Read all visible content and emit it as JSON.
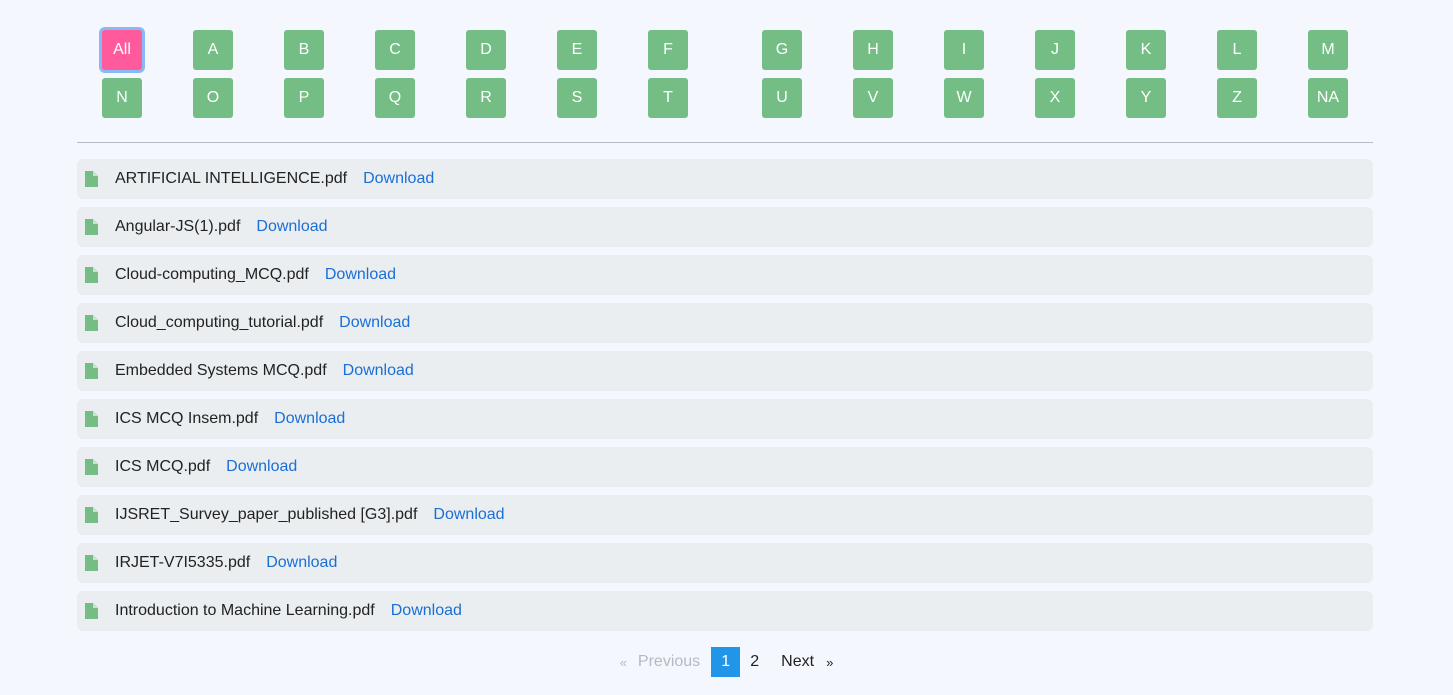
{
  "alphabet_filter": {
    "row1": [
      "All",
      "A",
      "B",
      "C",
      "D",
      "E",
      "F",
      "G",
      "H",
      "I",
      "J",
      "K",
      "L",
      "M"
    ],
    "row2": [
      "N",
      "O",
      "P",
      "Q",
      "R",
      "S",
      "T",
      "U",
      "V",
      "W",
      "X",
      "Y",
      "Z",
      "NA"
    ],
    "active": "All"
  },
  "files": [
    {
      "name": "ARTIFICIAL INTELLIGENCE.pdf",
      "link": "Download"
    },
    {
      "name": "Angular-JS(1).pdf",
      "link": "Download"
    },
    {
      "name": "Cloud-computing_MCQ.pdf",
      "link": "Download"
    },
    {
      "name": "Cloud_computing_tutorial.pdf",
      "link": "Download"
    },
    {
      "name": "Embedded Systems MCQ.pdf",
      "link": "Download"
    },
    {
      "name": "ICS MCQ Insem.pdf",
      "link": "Download"
    },
    {
      "name": "ICS MCQ.pdf",
      "link": "Download"
    },
    {
      "name": "IJSRET_Survey_paper_published [G3].pdf",
      "link": "Download"
    },
    {
      "name": "IRJET-V7I5335.pdf",
      "link": "Download"
    },
    {
      "name": "Introduction to Machine Learning.pdf",
      "link": "Download"
    }
  ],
  "file_icon": "file-icon",
  "pagination": {
    "prev_arrow": "«",
    "prev_label": "Previous",
    "pages": [
      "1",
      "2"
    ],
    "current_page": "1",
    "next_label": "Next",
    "next_arrow": "»"
  },
  "colors": {
    "letter_button": "#74be86",
    "active_letter": "#ff5a9c",
    "link": "#1a6fd6",
    "current_page": "#2196e9",
    "row_background": "#eaeef0"
  }
}
